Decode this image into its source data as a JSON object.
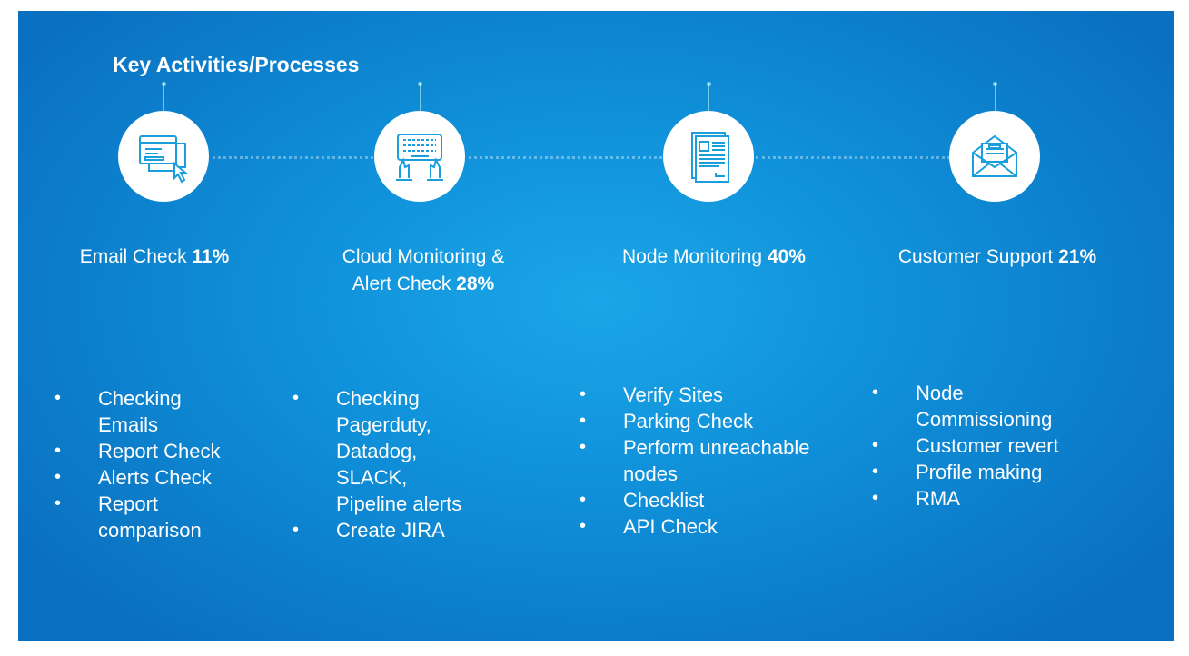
{
  "title": "Key Activities/Processes",
  "activities": [
    {
      "icon": "browser-cursor-icon",
      "name": "Email Check ",
      "percent": "11%",
      "items": [
        "Checking Emails",
        "Report Check",
        "Alerts Check",
        "Report comparison"
      ]
    },
    {
      "icon": "keyboard-hands-icon",
      "name_line1": "Cloud Monitoring &",
      "name_line2": "Alert Check ",
      "percent": "28%",
      "items": [
        "Checking Pagerduty, Datadog, SLACK, Pipeline alerts",
        "Create JIRA"
      ]
    },
    {
      "icon": "document-icon",
      "name": "Node Monitoring ",
      "percent": "40%",
      "items": [
        "Verify  Sites",
        "Parking Check",
        "Perform unreachable nodes",
        "Checklist",
        "API Check"
      ]
    },
    {
      "icon": "envelope-icon",
      "name": "Customer Support ",
      "percent": "21%",
      "items": [
        "Node Commissioning",
        "Customer revert",
        "Profile making",
        "RMA"
      ]
    }
  ],
  "colors": {
    "background": "#0f8fd8",
    "text": "#ffffff",
    "icon_stroke": "#1a9fdc"
  }
}
